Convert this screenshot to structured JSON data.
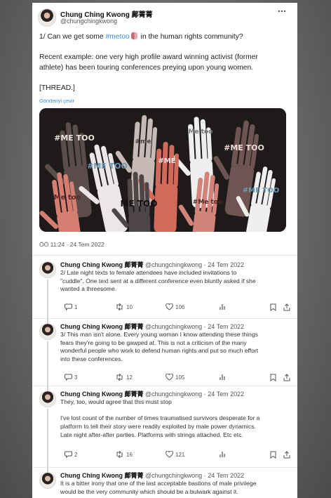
{
  "main_tweet": {
    "name": "Chung Ching Kwong 鄺菁菁",
    "handle": "@chungchingkwong",
    "line1_pre": "1/ Can we get some ",
    "line1_tag": "#metoo",
    "line1_post": " in the human rights community?",
    "line2": "Recent example: one very high profile award winning activist (former",
    "line3": "athlete) has been touring conferences preying upon young women.",
    "line4": "[THREAD.]",
    "translate": "Gönderiyi çevir",
    "timestamp": "ÖÖ 11:24 · 24 Tem 2022",
    "image_hand_labels": [
      "#ME TOO",
      "#ME",
      "#ME TOO",
      "ME TOO",
      "Me too",
      "#ME TOO",
      "Me too",
      "ME TOO",
      "#Me too",
      "#ME TOO",
      "#me"
    ]
  },
  "replies": [
    {
      "name": "Chung Ching Kwong 鄺菁菁",
      "handle": "@chungchingkwong",
      "date": "24 Tem 2022",
      "lines": [
        "2/ Late night texts to female attendees have included invitations to",
        "\"cuddle\". One text sent at a different conference even bluntly asked if she",
        "wanted a threesome."
      ],
      "replies": "1",
      "retweets": "10",
      "likes": "106"
    },
    {
      "name": "Chung Ching Kwong 鄺菁菁",
      "handle": "@chungchingkwong",
      "date": "24 Tem 2022",
      "lines": [
        "3/ This man isn't alone. Every young woman I know attending these things",
        "fears they're going to be gawped at. This is not a criticism of the many",
        "wonderful people who work to defend human rights and put so much effort",
        "into these conferences."
      ],
      "replies": "3",
      "retweets": "12",
      "likes": "105"
    },
    {
      "name": "Chung Ching Kwong 鄺菁菁",
      "handle": "@chungchingkwong",
      "date": "24 Tem 2022",
      "lines": [
        "They, too, would agree that this must stop",
        "",
        "I've lost count of the number of times traumatised survivors desperate for a",
        "platform to tell their story were readily exploited by male power dynamics.",
        "Late night after-after parties. Platforms with strings attached. Etc etc."
      ],
      "replies": "2",
      "retweets": "16",
      "likes": "121"
    },
    {
      "name": "Chung Ching Kwong 鄺菁菁",
      "handle": "@chungchingkwong",
      "date": "24 Tem 2022",
      "lines": [
        "It is a bitter irony that one of the last acceptable bastions of male privilege",
        "would be the very community which should be a bulwark against it."
      ]
    }
  ],
  "colors": {
    "link": "#3b8fd6",
    "text": "#222222",
    "muted": "#555555",
    "page_bg": "#6f6f6f"
  },
  "icons": [
    "more-icon",
    "reply-icon",
    "retweet-icon",
    "like-icon",
    "views-icon",
    "bookmark-icon",
    "share-icon"
  ]
}
